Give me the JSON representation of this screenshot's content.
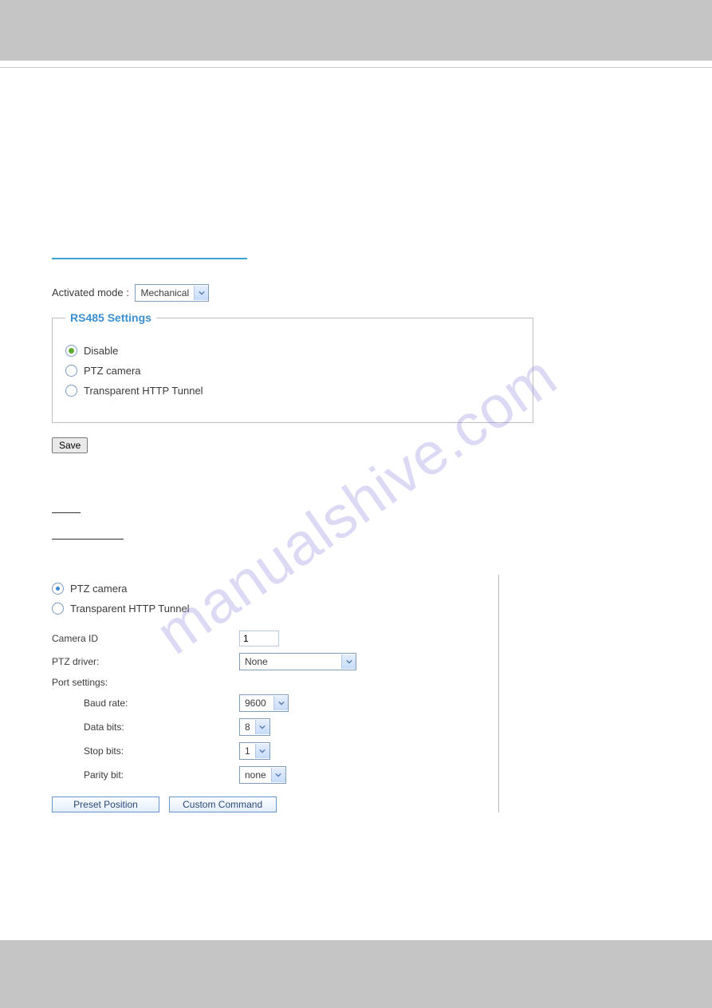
{
  "watermark": "manualshive.com",
  "top": {
    "activated_mode_label": "Activated mode :",
    "activated_mode_value": "Mechanical"
  },
  "rs485": {
    "legend": "RS485 Settings",
    "options": {
      "disable": "Disable",
      "ptz": "PTZ camera",
      "tunnel": "Transparent HTTP Tunnel"
    },
    "selected": "disable"
  },
  "buttons": {
    "save": "Save",
    "preset_position": "Preset Position",
    "custom_command": "Custom Command"
  },
  "ptz": {
    "options": {
      "ptz": "PTZ camera",
      "tunnel": "Transparent HTTP Tunnel"
    },
    "selected": "ptz",
    "camera_id_label": "Camera ID",
    "camera_id_value": "1",
    "ptz_driver_label": "PTZ driver:",
    "ptz_driver_value": "None",
    "port_settings_label": "Port settings:",
    "baud_rate_label": "Baud rate:",
    "baud_rate_value": "9600",
    "data_bits_label": "Data bits:",
    "data_bits_value": "8",
    "stop_bits_label": "Stop bits:",
    "stop_bits_value": "1",
    "parity_label": "Parity bit:",
    "parity_value": "none"
  }
}
